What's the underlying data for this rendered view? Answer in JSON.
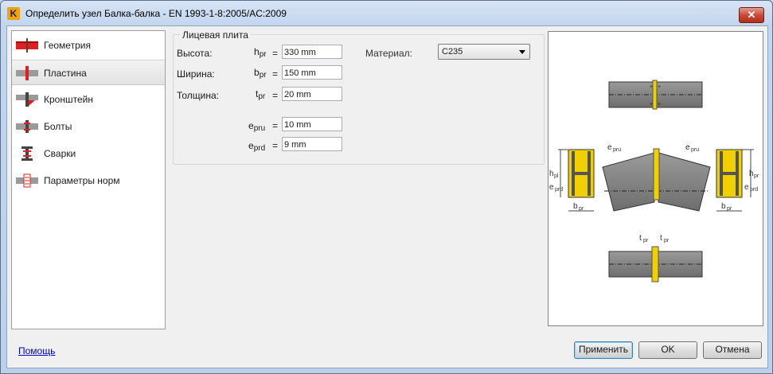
{
  "window": {
    "title": "Определить узел Балка-балка - EN 1993-1-8:2005/AC:2009",
    "close_label": "✕",
    "app_icon_letter": "K"
  },
  "nav": {
    "items": [
      {
        "label": "Геометрия",
        "icon": "geometry-icon"
      },
      {
        "label": "Пластина",
        "icon": "plate-icon",
        "selected": true
      },
      {
        "label": "Кронштейн",
        "icon": "bracket-icon"
      },
      {
        "label": "Болты",
        "icon": "bolts-icon"
      },
      {
        "label": "Сварки",
        "icon": "welds-icon"
      },
      {
        "label": "Параметры норм",
        "icon": "code-params-icon"
      }
    ]
  },
  "plate": {
    "group_title": "Лицевая плита",
    "height": {
      "label": "Высота:",
      "sym": "h",
      "sub": "pr",
      "eq": "=",
      "value": "330 mm"
    },
    "width": {
      "label": "Ширина:",
      "sym": "b",
      "sub": "pr",
      "eq": "=",
      "value": "150 mm"
    },
    "thickness": {
      "label": "Толщина:",
      "sym": "t",
      "sub": "pr",
      "eq": "=",
      "value": "20 mm"
    },
    "e_pru": {
      "sym": "e",
      "sub": "pru",
      "eq": "=",
      "value": "10 mm"
    },
    "e_prd": {
      "sym": "e",
      "sub": "prd",
      "eq": "=",
      "value": "9 mm"
    },
    "material": {
      "label": "Материал:",
      "value": "C235"
    }
  },
  "preview": {
    "labels": {
      "e_pru": "e",
      "e_pru_sub": "pru",
      "e_prd": "e",
      "e_prd_sub": "prd",
      "h_pl": "h",
      "h_pl_sub": "pl",
      "h_pr": "h",
      "h_pr_sub": "pr",
      "b_pr": "b",
      "b_pr_sub": "pr",
      "t_pr": "t",
      "t_pr_sub": "pr"
    }
  },
  "footer": {
    "help": "Помощь",
    "apply": "Применить",
    "ok": "OK",
    "cancel": "Отмена"
  },
  "colors": {
    "accent_red": "#e02020",
    "plate_yellow": "#f0d000",
    "beam_gray": "#7f7f7f"
  }
}
